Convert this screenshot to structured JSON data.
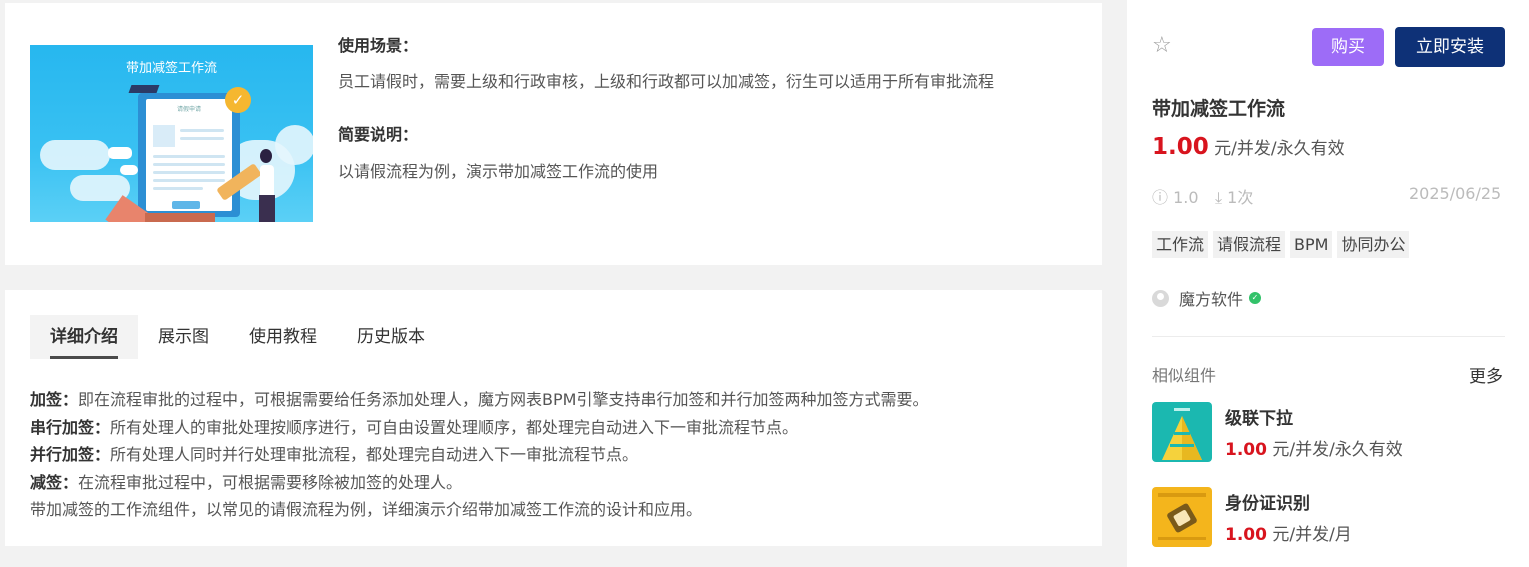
{
  "top": {
    "thumb_title": "带加减签工作流",
    "thumb_doc_title": "请假申请",
    "thumb_button": "提交",
    "usage_title": "使用场景：",
    "usage_text": "员工请假时，需要上级和行政审核，上级和行政都可以加减签，衍生可以适用于所有审批流程",
    "brief_title": "简要说明：",
    "brief_text": "以请假流程为例，演示带加减签工作流的使用"
  },
  "tabs": [
    "详细介绍",
    "展示图",
    "使用教程",
    "历史版本"
  ],
  "active_tab": "详细介绍",
  "desc": [
    {
      "bold": "加签：",
      "text": "即在流程审批的过程中，可根据需要给任务添加处理人，魔方网表BPM引擎支持串行加签和并行加签两种加签方式需要。"
    },
    {
      "bold": "串行加签：",
      "text": "所有处理人的审批处理按顺序进行，可自由设置处理顺序，都处理完自动进入下一审批流程节点。"
    },
    {
      "bold": "并行加签：",
      "text": "所有处理人同时并行处理审批流程，都处理完自动进入下一审批流程节点。"
    },
    {
      "bold": "减签：",
      "text": "在流程审批过程中，可根据需要移除被加签的处理人。"
    },
    {
      "bold": "",
      "text": "带加减签的工作流组件，以常见的请假流程为例，详细演示介绍带加减签工作流的设计和应用。"
    }
  ],
  "side": {
    "star_icon": "star-outline-icon",
    "buy_label": "购买",
    "install_label": "立即安装",
    "title": "带加减签工作流",
    "price": "1.00",
    "price_unit": " 元/并发/永久有效",
    "version": "1.0",
    "downloads": "1次",
    "date": "2025/06/25",
    "tags": [
      "工作流",
      "请假流程",
      "BPM",
      "协同办公"
    ],
    "vendor": "魔方软件",
    "similar_title": "相似组件",
    "more_label": "更多",
    "similar": [
      {
        "name": "级联下拉",
        "price": "1.00",
        "unit": " 元/并发/永久有效",
        "icon_color": "#1bb8b0"
      },
      {
        "name": "身份证识别",
        "price": "1.00",
        "unit": " 元/并发/月",
        "icon_color": "#f4b51c"
      }
    ]
  },
  "colors": {
    "buy": "#9d6cf7",
    "install": "#0e3177",
    "price": "#d8141e"
  }
}
